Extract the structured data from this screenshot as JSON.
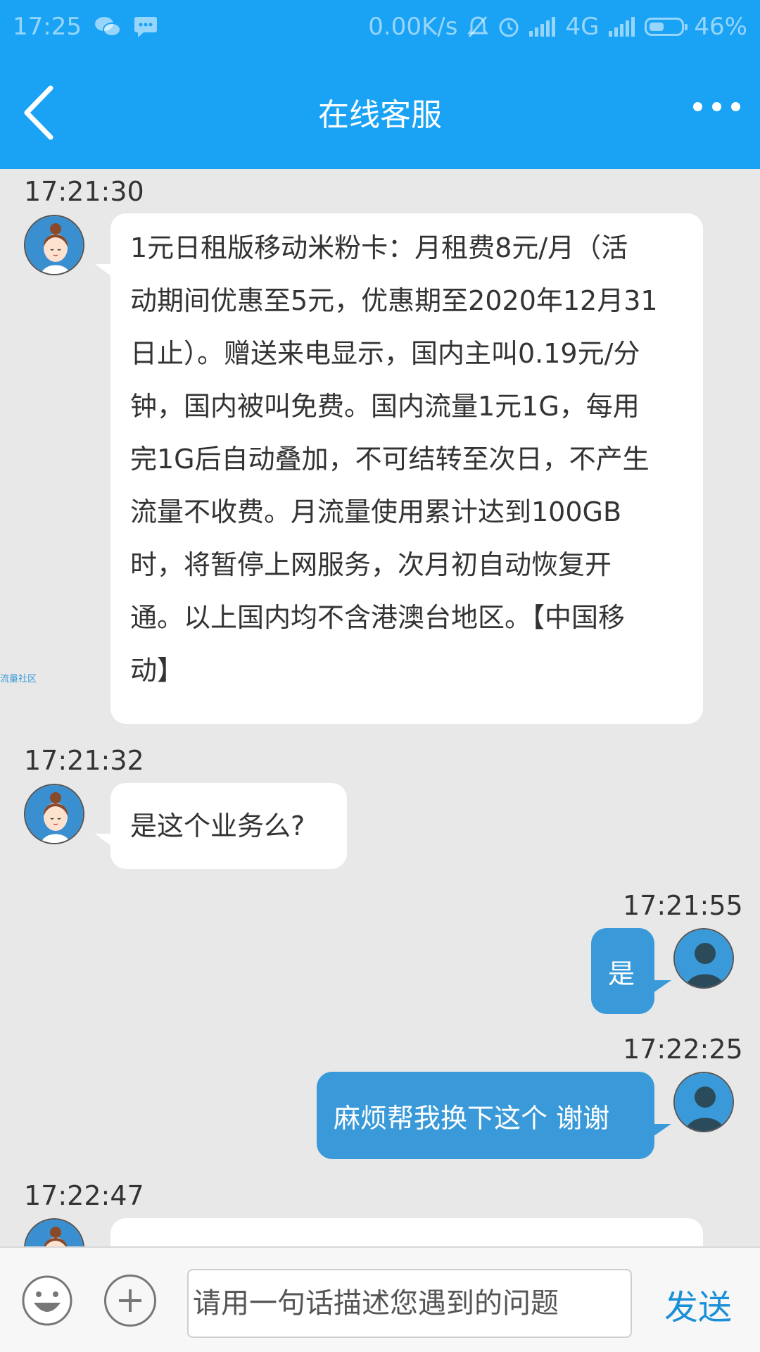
{
  "status_bar": {
    "time": "17:25",
    "net_speed": "0.00K/s",
    "network": "4G",
    "battery": "46%",
    "battery_level": 0.46,
    "icons": [
      "wechat-icon",
      "message-icon",
      "mute-icon",
      "alarm-icon",
      "signal-icon",
      "battery-icon"
    ]
  },
  "nav": {
    "title": "在线客服",
    "back_icon": "back-arrow-icon",
    "more_icon": "more-dots-icon"
  },
  "side_watermark": "流量社区",
  "messages": [
    {
      "sender": "agent",
      "time": "17:21:30",
      "lines": [
        "1元日租版移动米粉卡：月租费8元/月（活",
        "动期间优惠至5元，优惠期至2020年12月31",
        "日止）。赠送来电显示，国内主叫0.19元/分",
        "钟，国内被叫免费。国内流量1元1G，每用",
        "完1G后自动叠加，不可结转至次日，不产生",
        "流量不收费。月流量使用累计达到100GB",
        "时，将暂停上网服务，次月初自动恢复开",
        "通。以上国内均不含港澳台地区。【中国移",
        "动】"
      ]
    },
    {
      "sender": "agent",
      "time": "17:21:32",
      "lines": [
        "是这个业务么?"
      ]
    },
    {
      "sender": "user",
      "time": "17:21:55",
      "text": "是"
    },
    {
      "sender": "user",
      "time": "17:22:25",
      "text": "麻烦帮我换下这个 谢谢"
    },
    {
      "sender": "agent",
      "time": "17:22:47",
      "lines": [
        ""
      ]
    }
  ],
  "input": {
    "placeholder": "请用一句话描述您遇到的问题",
    "value": "",
    "send_label": "发送",
    "emoji_icon": "smiley-icon",
    "plus_icon": "plus-icon"
  },
  "colors": {
    "header": "#1aa3f5",
    "user_bubble": "#3a9ad9",
    "agent_bubble": "#ffffff",
    "chat_background": "#e8e8e8",
    "send_text": "#1a8fd8"
  }
}
